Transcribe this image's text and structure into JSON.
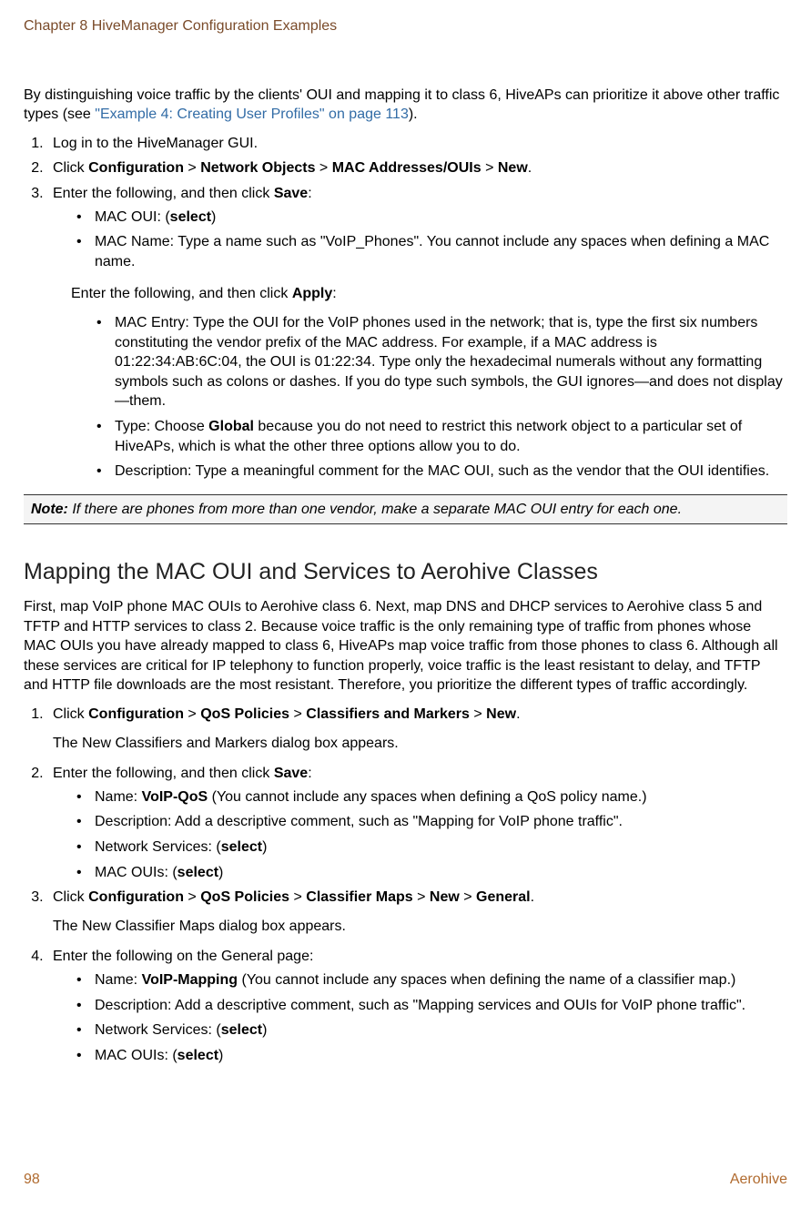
{
  "header": "Chapter 8 HiveManager Configuration Examples",
  "intro": {
    "p1a": "By distinguishing voice traffic by the clients' OUI and mapping it to class 6, HiveAPs can prioritize it above other traffic types (see ",
    "link": "\"Example 4: Creating User Profiles\" on page 113",
    "p1c": ")."
  },
  "steps1": {
    "s1": "Log in to the HiveManager GUI.",
    "s2_a": "Click ",
    "s2_b": "Configuration",
    "s2_c": " > ",
    "s2_d": "Network Objects",
    "s2_e": " > ",
    "s2_f": "MAC Addresses/OUIs",
    "s2_g": " > ",
    "s2_h": "New",
    "s2_i": ".",
    "s3_a": "Enter the following, and then click ",
    "s3_b": "Save",
    "s3_c": ":",
    "s3_bul1_a": "MAC OUI: (",
    "s3_bul1_b": "select",
    "s3_bul1_c": ")",
    "s3_bul2": "MAC Name: Type a name such as \"VoIP_Phones\". You cannot include any spaces when defining a MAC name.",
    "apply_a": "Enter the following, and then click ",
    "apply_b": "Apply",
    "apply_c": ":",
    "inner1": "MAC Entry: Type the OUI for the VoIP phones used in the network; that is, type the first six numbers constituting the vendor prefix of the MAC address. For example, if a MAC address is 01:22:34:AB:6C:04, the OUI is 01:22:34. Type only the hexadecimal numerals without any formatting symbols such as colons or dashes. If you do type such symbols, the GUI ignores—and does not display—them.",
    "inner2_a": "Type: Choose ",
    "inner2_b": "Global",
    "inner2_c": " because you do not need to restrict this network object to a particular set of HiveAPs, which is what the other three options allow you to do.",
    "inner3": "Description: Type a meaningful comment for the MAC OUI, such as the vendor that the OUI identifies."
  },
  "note": {
    "label": "Note:",
    "text": " If there are phones from more than one vendor, make a separate MAC OUI entry for each one."
  },
  "section_title": "Mapping the MAC OUI and Services to Aerohive Classes",
  "section_intro": "First, map VoIP phone MAC OUIs to Aerohive class 6. Next, map DNS and DHCP services to Aerohive class 5 and TFTP and HTTP services to class 2. Because voice traffic is the only remaining type of traffic from phones whose MAC OUIs you have already mapped to class 6, HiveAPs map voice traffic from those phones to class 6. Although all these services are critical for IP telephony to function properly, voice traffic is the least resistant to delay, and TFTP and HTTP file downloads are the most resistant. Therefore, you prioritize the different types of traffic accordingly.",
  "steps2": {
    "s1_a": "Click ",
    "s1_b": "Configuration",
    "s1_c": " > ",
    "s1_d": "QoS Policies",
    "s1_e": " > ",
    "s1_f": "Classifiers and Markers",
    "s1_g": " > ",
    "s1_h": "New",
    "s1_i": ".",
    "s1_dialog": "The New Classifiers and Markers dialog box appears.",
    "s2_a": "Enter the following, and then click ",
    "s2_b": "Save",
    "s2_c": ":",
    "s2_bul1_a": "Name: ",
    "s2_bul1_b": "VoIP-QoS",
    "s2_bul1_c": " (You cannot include any spaces when defining a QoS policy name.)",
    "s2_bul2": "Description: Add a descriptive comment, such as \"Mapping for VoIP phone traffic\".",
    "s2_bul3_a": "Network Services: (",
    "s2_bul3_b": "select",
    "s2_bul3_c": ")",
    "s2_bul4_a": "MAC OUIs: (",
    "s2_bul4_b": "select",
    "s2_bul4_c": ")",
    "s3_a": "Click ",
    "s3_b": "Configuration",
    "s3_c": " > ",
    "s3_d": "QoS Policies",
    "s3_e": " > ",
    "s3_f": "Classifier Maps",
    "s3_g": " > ",
    "s3_h": "New",
    "s3_i": " > ",
    "s3_j": "General",
    "s3_k": ".",
    "s3_dialog": "The New Classifier Maps dialog box appears.",
    "s4": "Enter the following on the General page:",
    "s4_bul1_a": "Name: ",
    "s4_bul1_b": "VoIP-Mapping",
    "s4_bul1_c": " (You cannot include any spaces when defining the name of a classifier map.)",
    "s4_bul2": "Description: Add a descriptive comment, such as \"Mapping services and OUIs for VoIP phone traffic\".",
    "s4_bul3_a": "Network Services: (",
    "s4_bul3_b": "select",
    "s4_bul3_c": ")",
    "s4_bul4_a": "MAC OUIs: (",
    "s4_bul4_b": "select",
    "s4_bul4_c": ")"
  },
  "footer": {
    "page": "98",
    "brand": "Aerohive"
  }
}
